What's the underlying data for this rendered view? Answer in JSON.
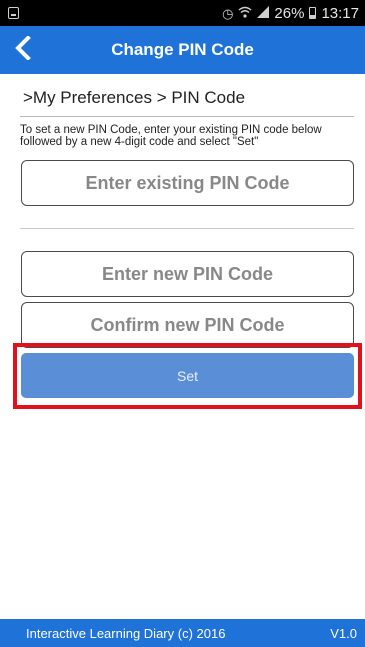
{
  "status_bar": {
    "battery": "26%",
    "time": "13:17",
    "icons": [
      "screenshot-icon",
      "alarm-icon",
      "wifi-icon",
      "signal-icon",
      "battery-icon"
    ]
  },
  "app_bar": {
    "title": "Change PIN Code",
    "back_icon": "chevron-left-icon",
    "color": "#1E72D8"
  },
  "breadcrumb": ">My Preferences > PIN Code",
  "instructions": "To set a new PIN Code, enter your existing PIN code below followed by a new 4-digit code and select \"Set\"",
  "fields": {
    "existing_placeholder": "Enter existing PIN Code",
    "new_placeholder": "Enter new PIN Code",
    "confirm_placeholder": "Confirm new PIN Code"
  },
  "set_button": {
    "label": "Set",
    "color": "#5A8FD8",
    "highlight_color": "#E3111B"
  },
  "footer": {
    "app_name": "Interactive Learning Diary (c) 2016",
    "version": "V1.0"
  }
}
